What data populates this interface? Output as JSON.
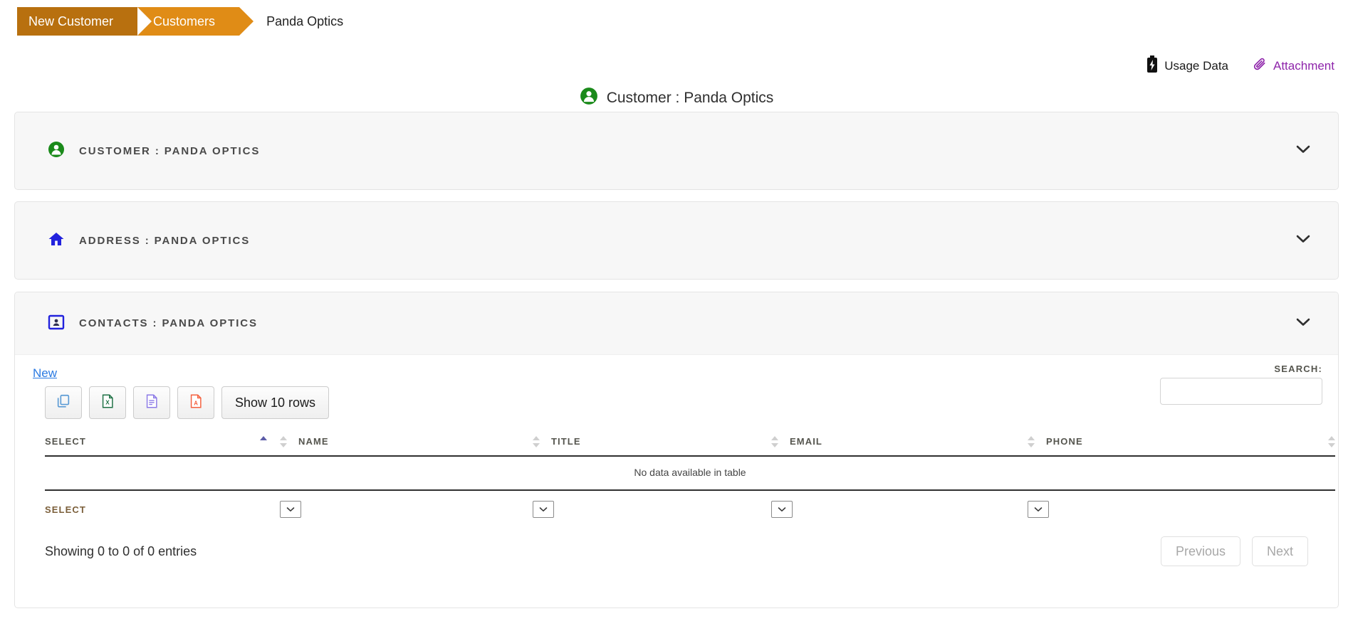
{
  "breadcrumb": {
    "items": [
      {
        "label": "New Customer",
        "style": "dark"
      },
      {
        "label": "Customers",
        "style": "light"
      },
      {
        "label": "Panda Optics",
        "style": "plain"
      }
    ]
  },
  "top_actions": {
    "usage_label": "Usage Data",
    "attachment_label": "Attachment",
    "attachment_color": "#8e24aa"
  },
  "page_title": "Customer : Panda Optics",
  "panels": [
    {
      "id": "customer",
      "title": "CUSTOMER : PANDA OPTICS",
      "icon": "person-circle-icon",
      "icon_color": "#1a8a1a",
      "collapsed": true
    },
    {
      "id": "address",
      "title": "ADDRESS : PANDA OPTICS",
      "icon": "home-icon",
      "icon_color": "#2222dd",
      "collapsed": true
    },
    {
      "id": "contacts",
      "title": "CONTACTS : PANDA OPTICS",
      "icon": "contact-card-icon",
      "icon_color": "#2222dd",
      "collapsed": false
    }
  ],
  "contacts": {
    "new_label": "New",
    "tools": [
      {
        "name": "copy-button",
        "icon": "copy-icon",
        "color": "#5b9bd5"
      },
      {
        "name": "excel-button",
        "icon": "excel-icon",
        "color": "#1e7145"
      },
      {
        "name": "csv-button",
        "icon": "csv-document-icon",
        "color": "#8c7ae6"
      },
      {
        "name": "pdf-button",
        "icon": "pdf-icon",
        "color": "#f4603e"
      }
    ],
    "show_rows_label": "Show 10 rows",
    "search_label": "SEARCH:",
    "search_value": "",
    "search_placeholder": "",
    "table": {
      "columns": [
        {
          "label": "SELECT",
          "sort": "asc"
        },
        {
          "label": "NAME",
          "sort": "none"
        },
        {
          "label": "TITLE",
          "sort": "none"
        },
        {
          "label": "EMAIL",
          "sort": "none"
        },
        {
          "label": "PHONE",
          "sort": "none"
        }
      ],
      "empty_message": "No data available in table",
      "footer_label": "SELECT",
      "footer_filters": [
        "",
        "",
        "",
        ""
      ]
    },
    "showing_text": "Showing 0 to 0 of 0 entries",
    "previous_label": "Previous",
    "next_label": "Next"
  }
}
